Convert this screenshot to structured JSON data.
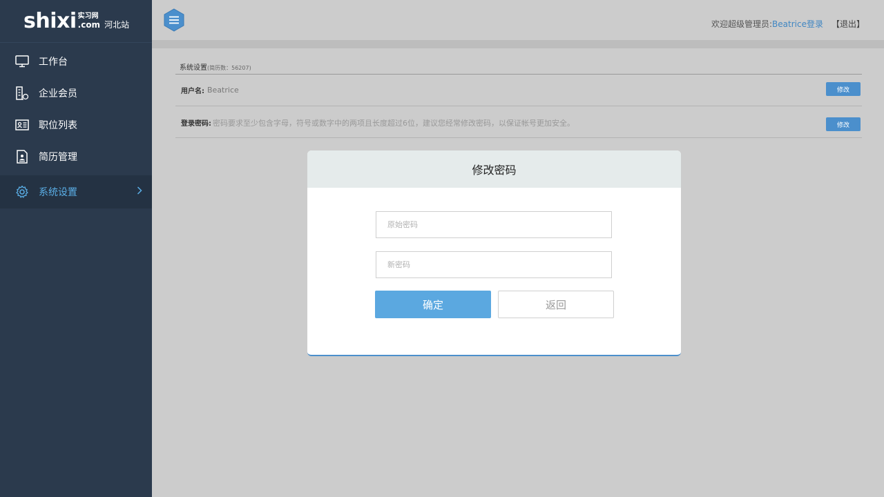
{
  "logo": {
    "mark": "shixi",
    "cn": "实习网",
    "com": ".com",
    "site": "河北站"
  },
  "sidebar": {
    "items": [
      {
        "label": "工作台",
        "icon": "monitor-icon"
      },
      {
        "label": "企业会员",
        "icon": "building-icon"
      },
      {
        "label": "职位列表",
        "icon": "id-card-icon"
      },
      {
        "label": "简历管理",
        "icon": "document-user-icon"
      },
      {
        "label": "系统设置",
        "icon": "gear-icon",
        "active": true
      }
    ]
  },
  "header": {
    "welcome": "欢迎超级管理员:",
    "user": "Beatrice登录",
    "logout": "【退出】"
  },
  "settings": {
    "title": "系统设置",
    "count": "(简历数：56207)",
    "username_label": "用户名:",
    "username_value": "Beatrice",
    "password_label": "登录密码:",
    "password_hint": "密码要求至少包含字母，符号或数字中的两项且长度超过6位，建议您经常修改密码，以保证帐号更加安全。",
    "edit_label": "修改"
  },
  "modal": {
    "title": "修改密码",
    "old_password_placeholder": "原始密码",
    "new_password_placeholder": "新密码",
    "confirm_label": "确定",
    "back_label": "返回"
  },
  "colors": {
    "sidebar_bg": "#2b3a4d",
    "accent": "#4b8fcc",
    "active_text": "#5aaee6",
    "page_bg": "#cccccc"
  }
}
